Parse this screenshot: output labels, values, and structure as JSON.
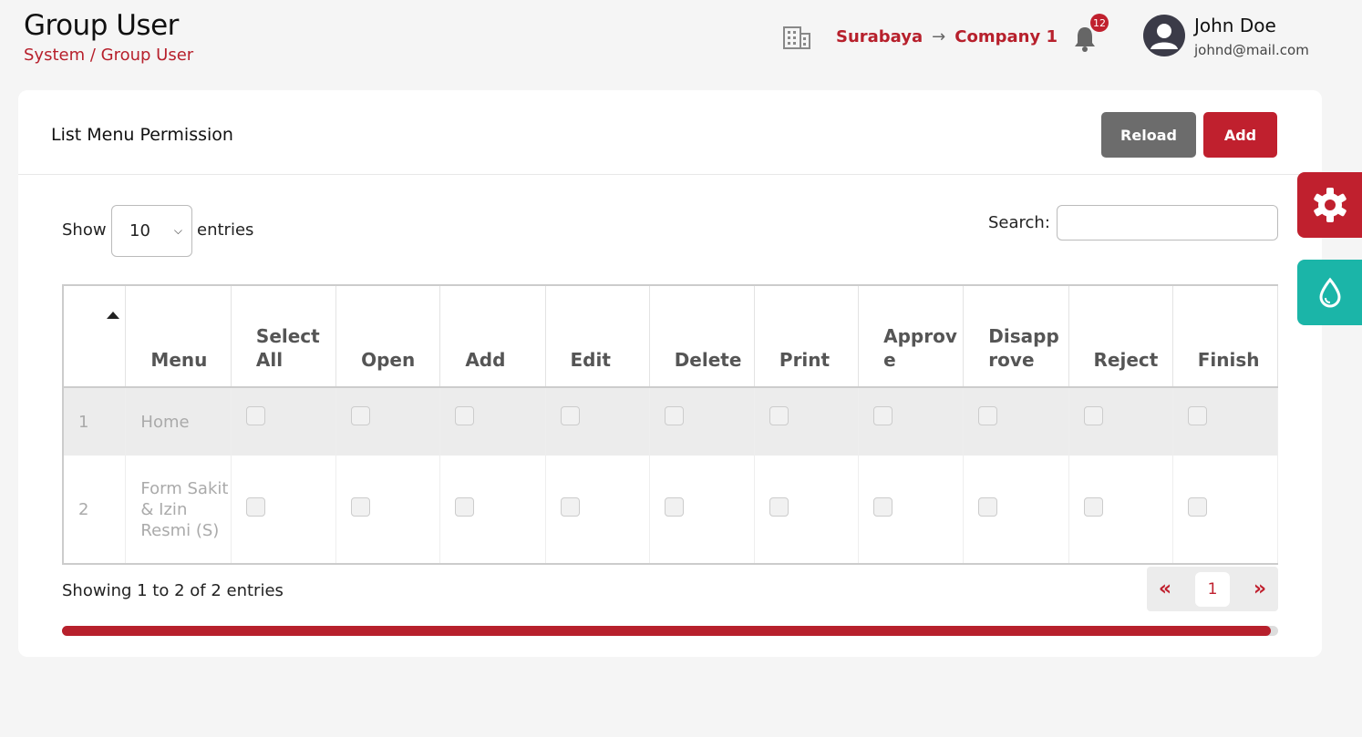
{
  "header": {
    "title": "Group User",
    "breadcrumb": "System / Group User",
    "location_city": "Surabaya",
    "location_arrow": "→",
    "location_company": "Company 1",
    "notification_count": "12",
    "user_name": "John Doe",
    "user_email": "johnd@mail.com"
  },
  "card": {
    "title": "List Menu Permission",
    "reload_label": "Reload",
    "add_label": "Add"
  },
  "controls": {
    "show_label": "Show",
    "page_size": "10",
    "entries_label": "entries",
    "search_label": "Search:",
    "search_value": ""
  },
  "table": {
    "columns": [
      "Menu",
      "Select All",
      "Open",
      "Add",
      "Edit",
      "Delete",
      "Print",
      "Approve",
      "Disapprove",
      "Reject",
      "Finish"
    ],
    "rows": [
      {
        "no": "1",
        "menu": "Home"
      },
      {
        "no": "2",
        "menu": "Form Sakit & Izin Resmi (S)"
      }
    ]
  },
  "footer": {
    "info": "Showing 1 to 2 of 2 entries",
    "prev": "«",
    "page": "1",
    "next": "»",
    "scroll_fraction": 0.994
  },
  "colors": {
    "accent": "#c0202e",
    "secondary": "#6c6c6c",
    "teal": "#1bb5a8"
  },
  "icons": {
    "building": "building-icon",
    "bell": "bell-icon",
    "avatar": "user-avatar-icon",
    "gear": "gear-icon",
    "drop": "drop-icon"
  }
}
